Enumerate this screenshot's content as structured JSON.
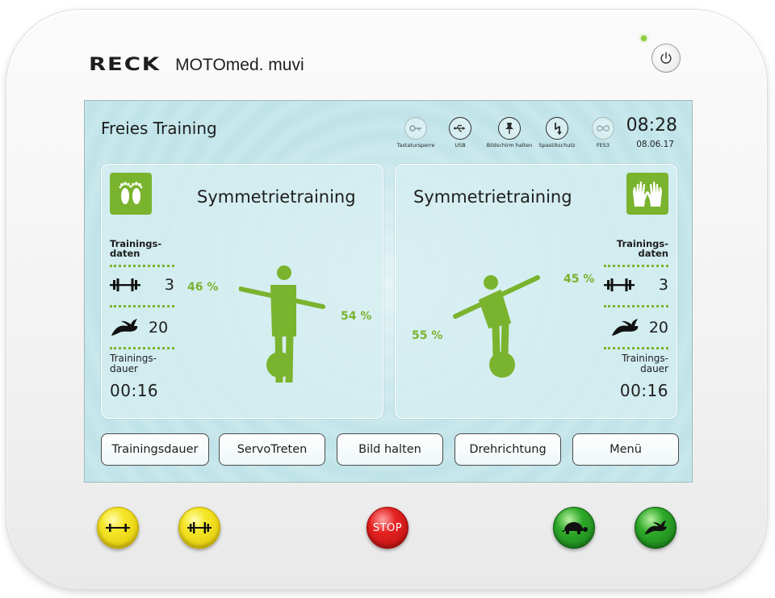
{
  "device": {
    "brand": "RECK",
    "model": "MOTOmed. muvi"
  },
  "screen": {
    "title": "Freies Training",
    "status_items": [
      {
        "label": "Tastatursperre",
        "icon": "key-icon"
      },
      {
        "label": "USB",
        "icon": "usb-icon"
      },
      {
        "label": "Bildschirm halten",
        "icon": "pin-icon"
      },
      {
        "label": "Spastikschutz",
        "icon": "lightning-icon"
      },
      {
        "label": "FES3",
        "icon": "infinity-icon"
      }
    ],
    "time": "08:28",
    "date": "08.06.17"
  },
  "left_panel": {
    "limb_icon": "feet-icon",
    "heading": "Symmetrietraining",
    "stats_label": "Trainings-\ndaten",
    "resistance_value": "3",
    "speed_value": "20",
    "duration_label": "Trainings-\ndauer",
    "duration_value": "00:16",
    "left_percent": "46 %",
    "right_percent": "54 %",
    "left_share": 0.46
  },
  "right_panel": {
    "limb_icon": "hands-icon",
    "heading": "Symmetrietraining",
    "stats_label": "Trainings-\ndaten",
    "resistance_value": "3",
    "speed_value": "20",
    "duration_label": "Trainings-\ndauer",
    "duration_value": "00:16",
    "left_percent": "55 %",
    "right_percent": "45 %",
    "left_share": 0.55
  },
  "buttons": {
    "trainingsdauer": "Trainingsdauer",
    "servotreten": "ServoTreten",
    "bild_halten": "Bild halten",
    "drehrichtung": "Drehrichtung",
    "menu": "Menü"
  },
  "hardware_buttons": {
    "stop_label": "STOP"
  },
  "colors": {
    "accent_green": "#7ab32e",
    "screen_background": "#c4e6ea"
  }
}
